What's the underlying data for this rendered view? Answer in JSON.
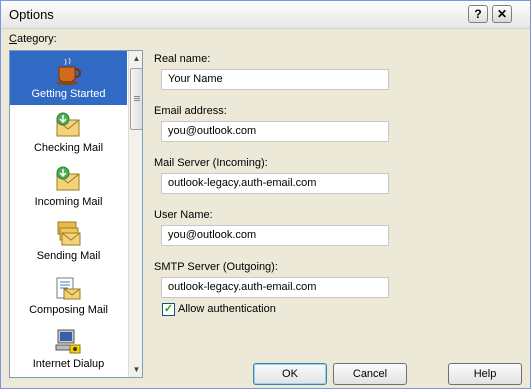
{
  "window": {
    "title": "Options"
  },
  "titlebar": {
    "help_glyph": "?",
    "close_glyph": "✕"
  },
  "category": {
    "label": "Category:",
    "items": [
      {
        "label": "Getting Started",
        "icon": "coffee-cup-icon",
        "selected": true
      },
      {
        "label": "Checking Mail",
        "icon": "envelope-icon",
        "selected": false
      },
      {
        "label": "Incoming Mail",
        "icon": "envelope-icon",
        "selected": false
      },
      {
        "label": "Sending Mail",
        "icon": "envelope-stack-icon",
        "selected": false
      },
      {
        "label": "Composing Mail",
        "icon": "compose-icon",
        "selected": false
      },
      {
        "label": "Internet Dialup",
        "icon": "dialup-computer-icon",
        "selected": false
      }
    ]
  },
  "form": {
    "real_name_label": "Real name:",
    "real_name_value": "Your Name",
    "email_label": "Email address:",
    "email_value": "you@outlook.com",
    "mail_server_label": "Mail Server (Incoming):",
    "mail_server_value": "outlook-legacy.auth-email.com",
    "user_name_label": "User Name:",
    "user_name_value": "you@outlook.com",
    "smtp_label": "SMTP Server (Outgoing):",
    "smtp_value": "outlook-legacy.auth-email.com",
    "allow_auth_label": "Allow authentication",
    "allow_auth_checked": true
  },
  "buttons": {
    "ok": "OK",
    "cancel": "Cancel",
    "help": "Help"
  }
}
